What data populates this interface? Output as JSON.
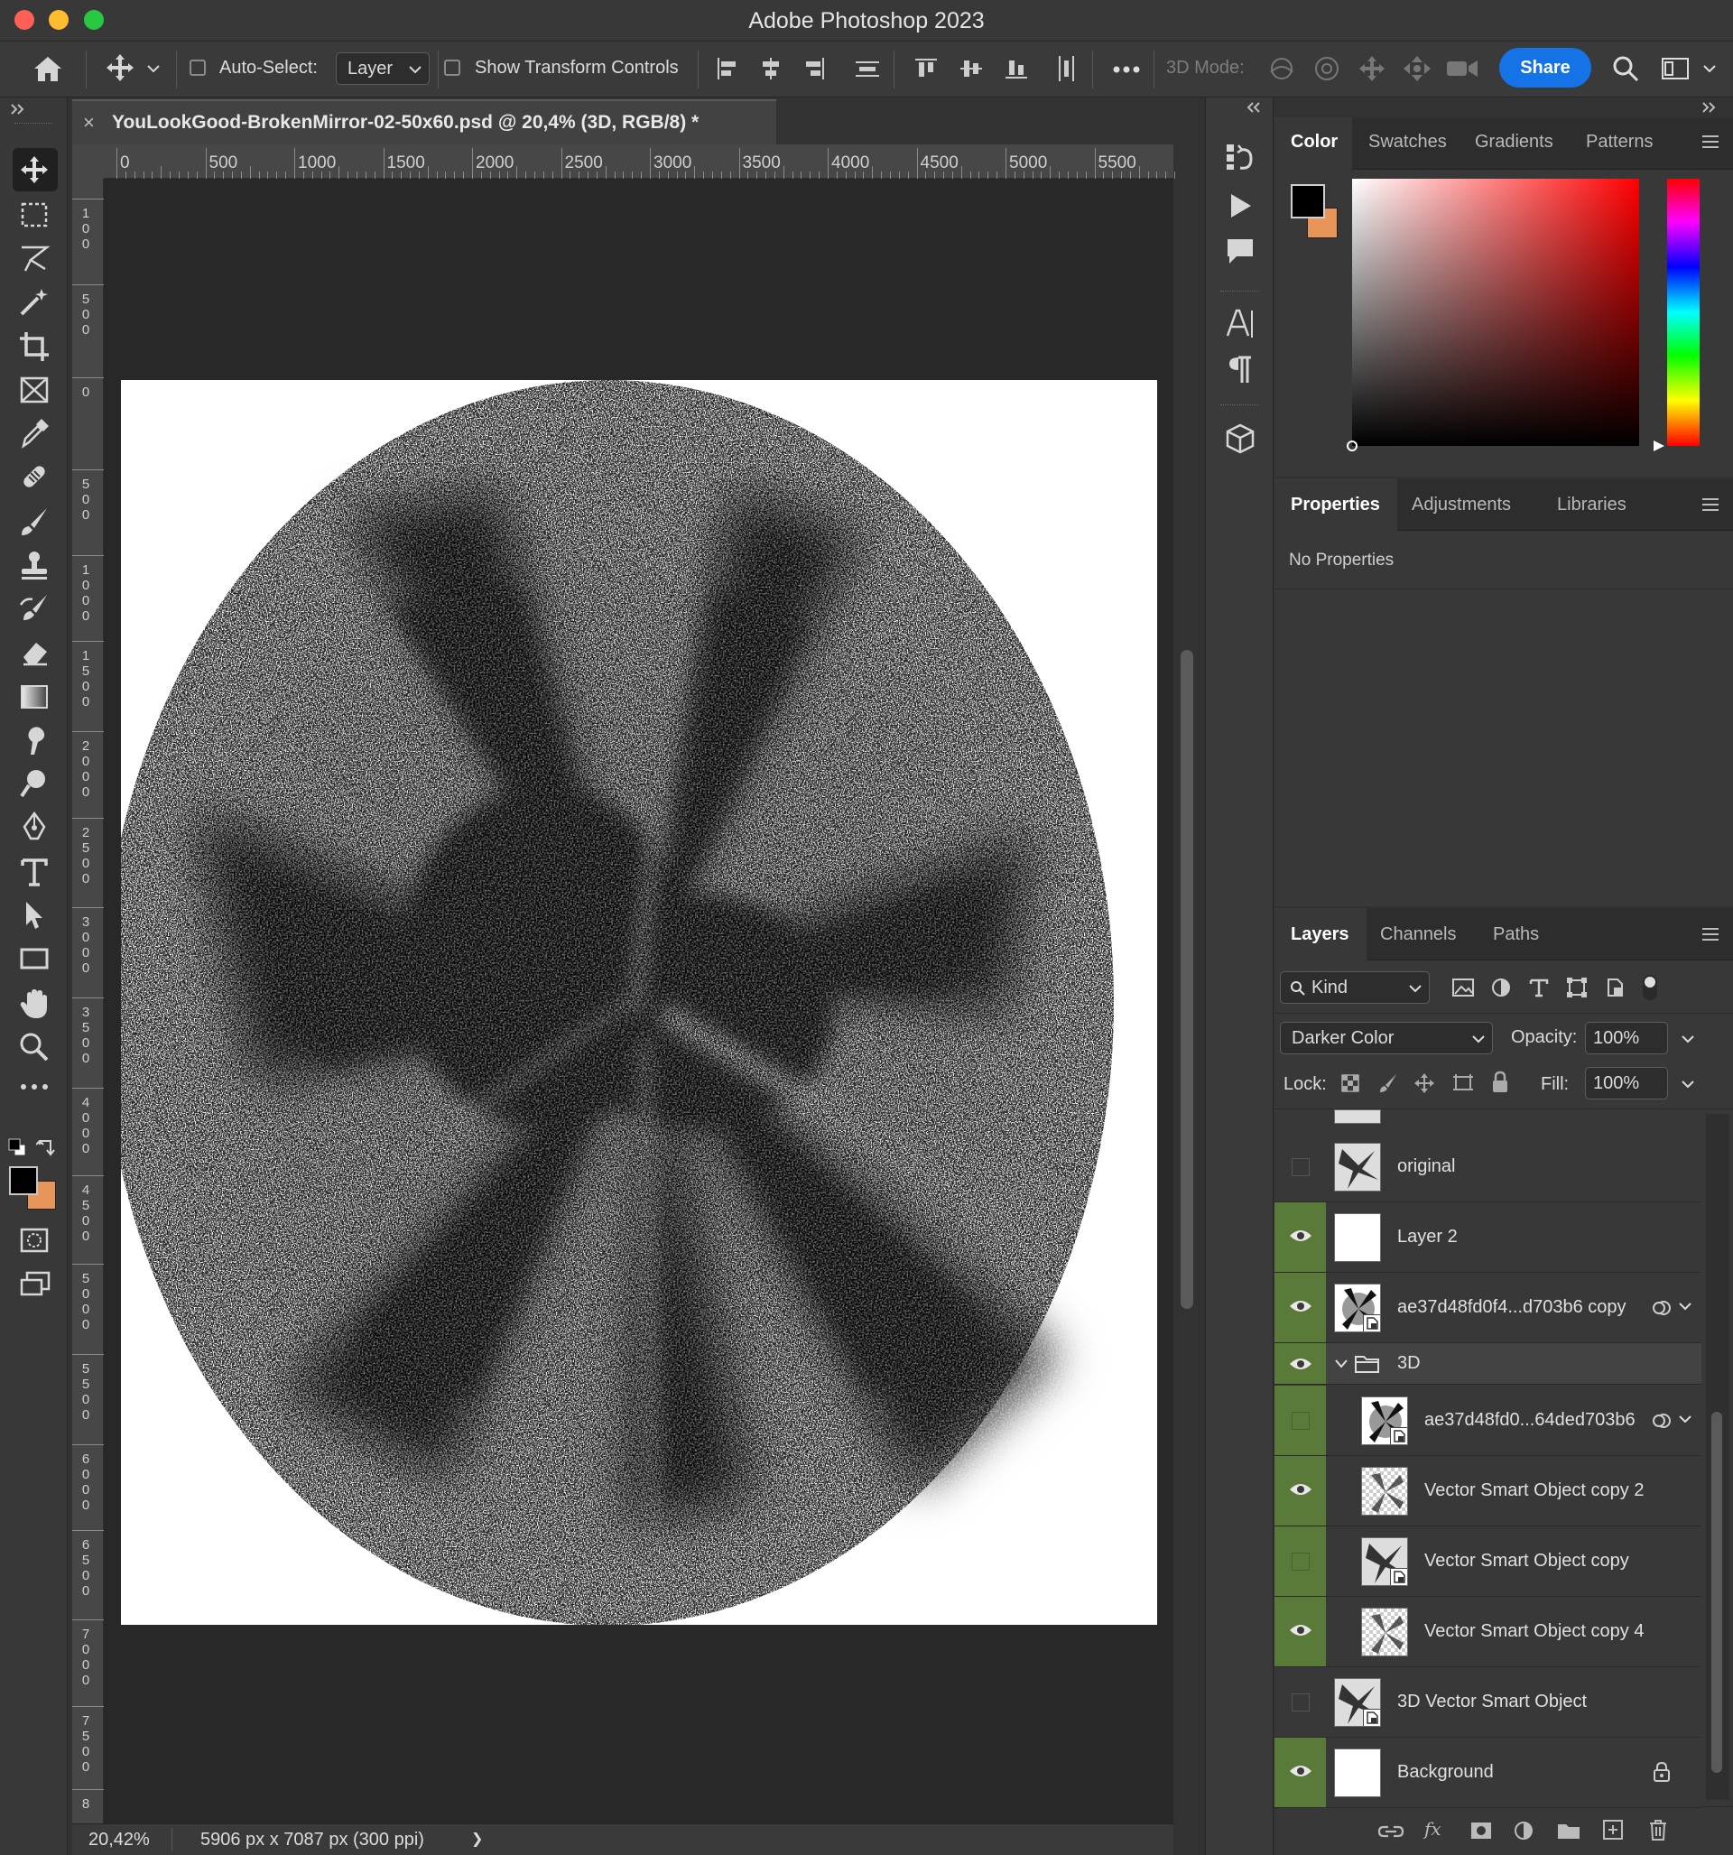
{
  "app_title": "Adobe Photoshop 2023",
  "options_bar": {
    "auto_select_label": "Auto-Select:",
    "auto_select_target": "Layer",
    "show_transform_label": "Show Transform Controls",
    "mode_3d_label": "3D Mode:",
    "share_label": "Share"
  },
  "document": {
    "tab_title": "YouLookGood-BrokenMirror-02-50x60.psd @ 20,4% (3D, RGB/8) *",
    "close_glyph": "×",
    "zoom": "20,42%",
    "size_info": "5906 px x 7087 px (300 ppi)",
    "status_arrow": "❯"
  },
  "rulers": {
    "horizontal": [
      "0",
      "500",
      "1000",
      "1500",
      "2000",
      "2500",
      "3000",
      "3500",
      "4000",
      "4500",
      "5000",
      "5500"
    ],
    "vertical": [
      "100",
      "500",
      "0",
      "500",
      "1000",
      "1500",
      "2000",
      "2500",
      "3000",
      "3500",
      "4000",
      "4500",
      "5000",
      "5500",
      "6000",
      "6500",
      "7000",
      "7500",
      "8"
    ]
  },
  "color_panel": {
    "tabs": [
      "Color",
      "Swatches",
      "Gradients",
      "Patterns"
    ],
    "active_tab": "Color",
    "foreground": "#000000",
    "background": "#e8955a",
    "hue_base": "#ff0000"
  },
  "properties_panel": {
    "tabs": [
      "Properties",
      "Adjustments",
      "Libraries"
    ],
    "empty_text": "No Properties"
  },
  "layers_panel": {
    "tabs": [
      "Layers",
      "Channels",
      "Paths"
    ],
    "filter_label": "Kind",
    "blend_mode": "Darker Color",
    "opacity_label": "Opacity:",
    "opacity_value": "100%",
    "lock_label": "Lock:",
    "fill_label": "Fill:",
    "fill_value": "100%",
    "layers": [
      {
        "name": "original",
        "visible": false,
        "indent": false,
        "thumb": "splash"
      },
      {
        "name": "Layer 2",
        "visible": true,
        "indent": false,
        "thumb": "white"
      },
      {
        "name": "ae37d48fd0f4...d703b6 copy",
        "visible": true,
        "indent": false,
        "thumb": "burst",
        "smart": true,
        "link": true
      },
      {
        "name": "3D",
        "visible": true,
        "indent": false,
        "group": true
      },
      {
        "name": "ae37d48fd0...64ded703b6",
        "visible": false,
        "indent": true,
        "thumb": "burst",
        "smart": true,
        "link": true
      },
      {
        "name": "Vector Smart Object copy 2",
        "visible": true,
        "indent": true,
        "thumb": "checker"
      },
      {
        "name": "Vector Smart Object copy",
        "visible": false,
        "indent": true,
        "thumb": "splash",
        "smart": true
      },
      {
        "name": "Vector Smart Object copy 4",
        "visible": true,
        "indent": true,
        "thumb": "checker"
      },
      {
        "name": "3D Vector Smart Object",
        "visible": false,
        "indent": false,
        "thumb": "splash",
        "smart": true
      },
      {
        "name": "Background",
        "visible": true,
        "indent": false,
        "thumb": "white",
        "locked": true
      }
    ]
  },
  "colors": {
    "accent": "#1473e6",
    "visible_green": "#5a7a3a"
  }
}
